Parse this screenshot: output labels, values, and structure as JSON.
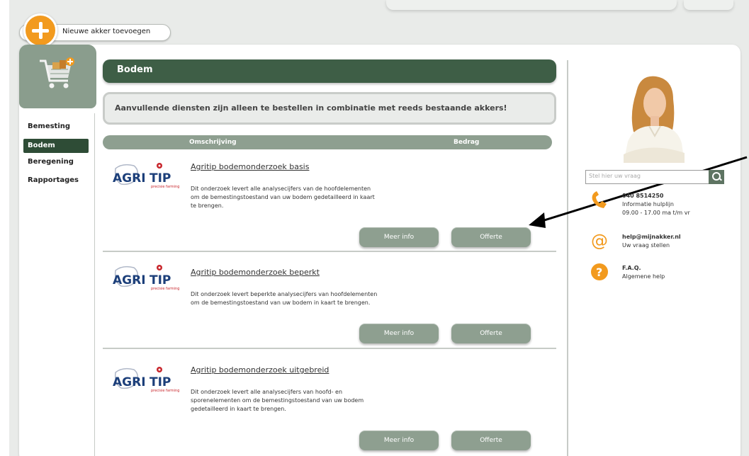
{
  "toolbar": {
    "add_field_label": "Nieuwe akker toevoegen"
  },
  "sidebar": {
    "items": [
      {
        "label": "Bemesting",
        "active": false
      },
      {
        "label": "Bodem",
        "active": true
      },
      {
        "label": "Beregening",
        "active": false
      },
      {
        "label": "Rapportages",
        "active": false
      }
    ]
  },
  "main": {
    "title": "Bodem",
    "notice": "Aanvullende diensten zijn alleen te bestellen in combinatie met reeds bestaande akkers!",
    "table_headers": {
      "description": "Omschrijving",
      "amount": "Bedrag"
    },
    "logo_text": "AGRI",
    "logo_text_accent": "TIP",
    "logo_tagline": "precisie farming",
    "products": [
      {
        "title": "Agritip bodemonderzoek basis",
        "description_lines": [
          "Dit onderzoek levert alle analysecijfers van de hoofdelementen",
          "om de bemestingstoestand van uw bodem gedetailleerd in kaart",
          "te brengen."
        ],
        "info_label": "Meer info",
        "quote_label": "Offerte"
      },
      {
        "title": "Agritip bodemonderzoek beperkt",
        "description_lines": [
          "Dit onderzoek levert beperkte analysecijfers van hoofdelementen",
          "om de bemestingstoestand van uw bodem in kaart te brengen."
        ],
        "info_label": "Meer info",
        "quote_label": "Offerte"
      },
      {
        "title": "Agritip bodemonderzoek uitgebreid",
        "description_lines": [
          "Dit onderzoek levert alle analysecijfers van hoofd- en",
          "sporenelementen om de bemestingstoestand van uw bodem",
          "gedetailleerd in kaart te brengen."
        ],
        "info_label": "Meer info",
        "quote_label": "Offerte"
      }
    ]
  },
  "help": {
    "search_placeholder": "Stel hier uw vraag",
    "phone": {
      "number": "040 8514250",
      "line1": "Informatie hulplijn",
      "line2": "09.00 - 17.00 ma t/m vr"
    },
    "email": {
      "address": "help@mijnakker.nl",
      "line1": "Uw vraag stellen"
    },
    "faq": {
      "title": "F.A.Q.",
      "line1": "Algemene help"
    }
  },
  "colors": {
    "brand_dark_green": "#3e5e46",
    "sidebar_active": "#2e4c36",
    "button_green_grey": "#8e9f90",
    "accent_orange": "#f29a1e"
  }
}
